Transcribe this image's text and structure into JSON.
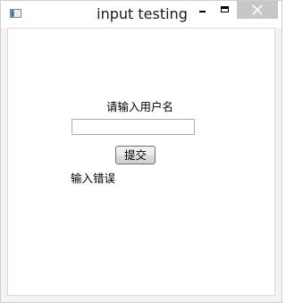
{
  "window": {
    "title": "input testing",
    "icon": "app-window-icon",
    "controls": {
      "minimize_icon": "minimize-icon",
      "maximize_icon": "maximize-icon",
      "close_icon": "close-icon"
    },
    "colors": {
      "titlebar_bg": "#ffffff",
      "close_bg": "#c7c7c7",
      "client_bg": "#ffffff"
    }
  },
  "form": {
    "prompt_label": "请输入用户名",
    "username_value": "",
    "submit_label": "提交",
    "error_message": "输入错误"
  }
}
